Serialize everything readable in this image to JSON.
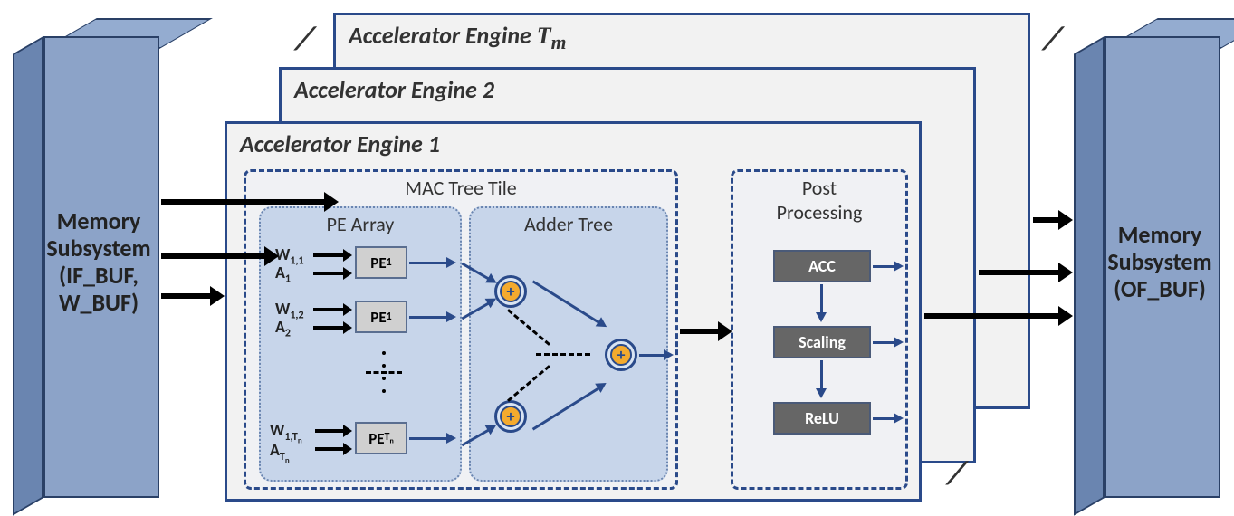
{
  "memory_left": {
    "line1": "Memory",
    "line2": "Subsystem",
    "line3": "(IF_BUF,",
    "line4": "W_BUF)"
  },
  "memory_right": {
    "line1": "Memory",
    "line2": "Subsystem",
    "line3": "(OF_BUF)"
  },
  "engines": {
    "e1": "Accelerator Engine 1",
    "e2": "Accelerator Engine 2",
    "em_prefix": "Accelerator Engine ",
    "em_sym": "T",
    "em_sub": "m"
  },
  "mac_tile": {
    "title": "MAC Tree Tile",
    "pe_array_title": "PE Array",
    "adder_tree_title": "Adder Tree",
    "inputs": {
      "w11": "W",
      "w11_sub": "1,1",
      "a1": "A",
      "a1_sub": "1",
      "w12": "W",
      "w12_sub": "1,2",
      "a2": "A",
      "a2_sub": "2",
      "w1tn_sub_a": "1,T",
      "w1tn_sub_b": "n",
      "atn_sub_a": "T",
      "atn_sub_b": "n"
    },
    "pe": {
      "label": "PE",
      "sub1": "1",
      "subtn_a": "T",
      "subtn_b": "n"
    },
    "plus": "+"
  },
  "post": {
    "title_l1": "Post",
    "title_l2": "Processing",
    "acc": "ACC",
    "scaling": "Scaling",
    "relu": "ReLU"
  }
}
